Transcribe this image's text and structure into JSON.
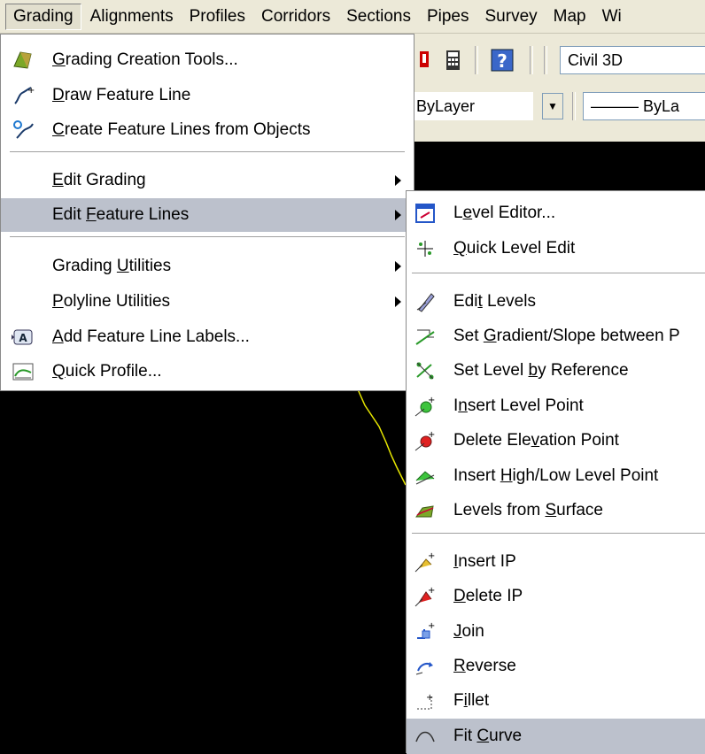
{
  "menubar": {
    "items": [
      "Grading",
      "Alignments",
      "Profiles",
      "Corridors",
      "Sections",
      "Pipes",
      "Survey",
      "Map",
      "Wi"
    ]
  },
  "toolbar": {
    "workspace": "Civil 3D",
    "layer": "ByLayer",
    "linetype": "——— ByLa"
  },
  "grading_menu": {
    "items": [
      {
        "pre": "",
        "u": "G",
        "post": "rading Creation Tools...",
        "icon": "grading-tools-icon"
      },
      {
        "pre": "",
        "u": "D",
        "post": "raw Feature Line",
        "icon": "draw-feature-line-icon"
      },
      {
        "pre": "",
        "u": "C",
        "post": "reate Feature Lines from Objects",
        "icon": "create-feature-lines-icon"
      },
      {
        "pre": "",
        "u": "E",
        "post": "dit Grading"
      },
      {
        "pre": "Edit ",
        "u": "F",
        "post": "eature Lines"
      },
      {
        "pre": "Grading ",
        "u": "U",
        "post": "tilities"
      },
      {
        "pre": "",
        "u": "P",
        "post": "olyline Utilities"
      },
      {
        "pre": "",
        "u": "A",
        "post": "dd Feature Line Labels...",
        "icon": "feature-line-labels-icon"
      },
      {
        "pre": "",
        "u": "Q",
        "post": "uick Profile...",
        "icon": "quick-profile-icon"
      }
    ]
  },
  "feature_lines_menu": {
    "items": [
      {
        "pre": "L",
        "u": "e",
        "post": "vel Editor..."
      },
      {
        "pre": "",
        "u": "Q",
        "post": "uick Level Edit"
      },
      {
        "pre": "Edi",
        "u": "t",
        "post": " Levels"
      },
      {
        "pre": "Set ",
        "u": "G",
        "post": "radient/Slope between P"
      },
      {
        "pre": "Set Level ",
        "u": "b",
        "post": "y Reference"
      },
      {
        "pre": "I",
        "u": "n",
        "post": "sert Level Point"
      },
      {
        "pre": "Delete Ele",
        "u": "v",
        "post": "ation Point"
      },
      {
        "pre": "Insert ",
        "u": "H",
        "post": "igh/Low Level Point"
      },
      {
        "pre": "Levels from ",
        "u": "S",
        "post": "urface"
      },
      {
        "pre": "",
        "u": "I",
        "post": "nsert IP"
      },
      {
        "pre": "",
        "u": "D",
        "post": "elete IP"
      },
      {
        "pre": "",
        "u": "J",
        "post": "oin"
      },
      {
        "pre": "",
        "u": "R",
        "post": "everse"
      },
      {
        "pre": "F",
        "u": "i",
        "post": "llet"
      },
      {
        "pre": "Fit ",
        "u": "C",
        "post": "urve"
      }
    ]
  },
  "colors": {
    "menu_bg": "#ffffff",
    "highlight": "#bcc1cc",
    "chrome": "#ece9d8",
    "canvas": "#000000",
    "feature_line": "#e6e600"
  }
}
